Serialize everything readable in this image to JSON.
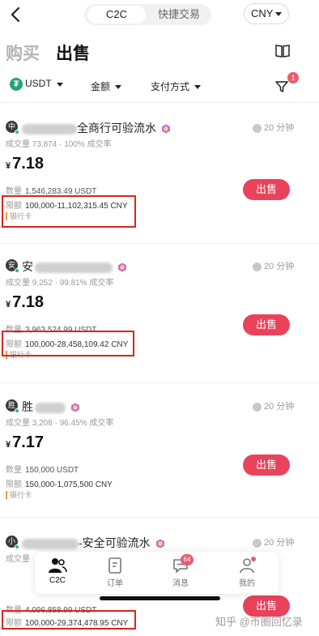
{
  "header": {
    "tab_c2c": "C2C",
    "tab_quick": "快捷交易",
    "currency": "CNY"
  },
  "trade_tabs": {
    "buy": "购买",
    "sell": "出售"
  },
  "filters": {
    "coin": "USDT",
    "amount": "金额",
    "payment": "支付方式",
    "filter_badge": "1"
  },
  "labels": {
    "qty": "数量",
    "limit": "限额",
    "sell_button": "出售",
    "yen": "¥"
  },
  "ads": [
    {
      "avatar": "中",
      "name_visible": "全商行可验流水",
      "time": "20 分钟",
      "stats": "成交量 73,874 · 100% 成交率",
      "price": "7.18",
      "qty": "1,546,283.49 USDT",
      "limit": "100,000-11,102,315.45 CNY",
      "payment": "银行卡"
    },
    {
      "avatar": "安",
      "name_visible": "安",
      "time": "20 分钟",
      "stats": "成交量 9,252 · 99.81% 成交率",
      "price": "7.18",
      "qty": "3,963,524.99 USDT",
      "limit": "100,000-28,458,109.42 CNY",
      "payment": "银行卡"
    },
    {
      "avatar": "胜",
      "name_visible": "胜",
      "time": "20 分钟",
      "stats": "成交量 3,208 · 96.45% 成交率",
      "price": "7.17",
      "qty": "150,000 USDT",
      "limit": "150,000-1,075,500 CNY",
      "payment": "银行卡"
    },
    {
      "avatar": "小",
      "name_visible": "-安全可验流水",
      "time": "20 分钟",
      "stats": "成交量",
      "price": "",
      "qty": "4,096,858.99 USDT",
      "limit": "100,000-29,374,478.95 CNY",
      "payment": ""
    }
  ],
  "nav": {
    "c2c": "C2C",
    "orders": "订单",
    "messages": "消息",
    "messages_badge": "64",
    "me": "我的"
  },
  "watermark": "知乎 @币圈回忆录",
  "colors": {
    "sell_button": "#e8435b",
    "highlight_box": "#d8261e",
    "online_dot": "#22c07a",
    "usdt": "#26a17b"
  }
}
